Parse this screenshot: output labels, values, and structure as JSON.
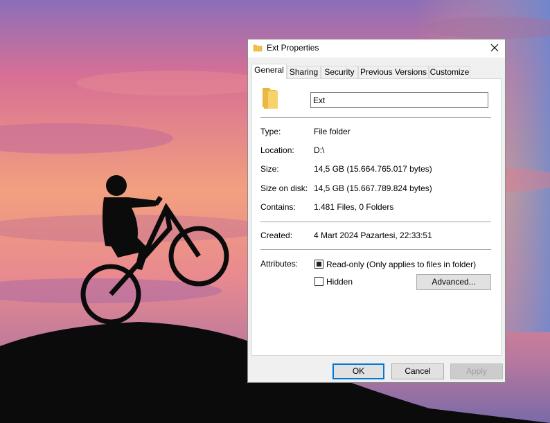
{
  "window": {
    "title": "Ext Properties",
    "close_icon": "close-icon"
  },
  "tabs": [
    {
      "label": "General",
      "active": true
    },
    {
      "label": "Sharing"
    },
    {
      "label": "Security"
    },
    {
      "label": "Previous Versions"
    },
    {
      "label": "Customize"
    }
  ],
  "general": {
    "folder_name": "Ext",
    "fields": [
      {
        "label": "Type:",
        "value": "File folder"
      },
      {
        "label": "Location:",
        "value": "D:\\"
      },
      {
        "label": "Size:",
        "value": "14,5 GB (15.664.765.017 bytes)"
      },
      {
        "label": "Size on disk:",
        "value": "14,5 GB (15.667.789.824 bytes)"
      },
      {
        "label": "Contains:",
        "value": "1.481 Files, 0 Folders"
      }
    ],
    "created": {
      "label": "Created:",
      "value": "4 Mart 2024 Pazartesi, 22:33:51"
    },
    "attributes": {
      "label": "Attributes:",
      "readonly": {
        "label": "Read-only (Only applies to files in folder)",
        "state": "indeterminate"
      },
      "hidden": {
        "label": "Hidden",
        "state": "unchecked"
      },
      "advanced_label": "Advanced..."
    }
  },
  "footer": {
    "ok_label": "OK",
    "cancel_label": "Cancel",
    "apply_label": "Apply"
  },
  "colors": {
    "accent": "#0078d7",
    "folder": "#f0c04a"
  }
}
